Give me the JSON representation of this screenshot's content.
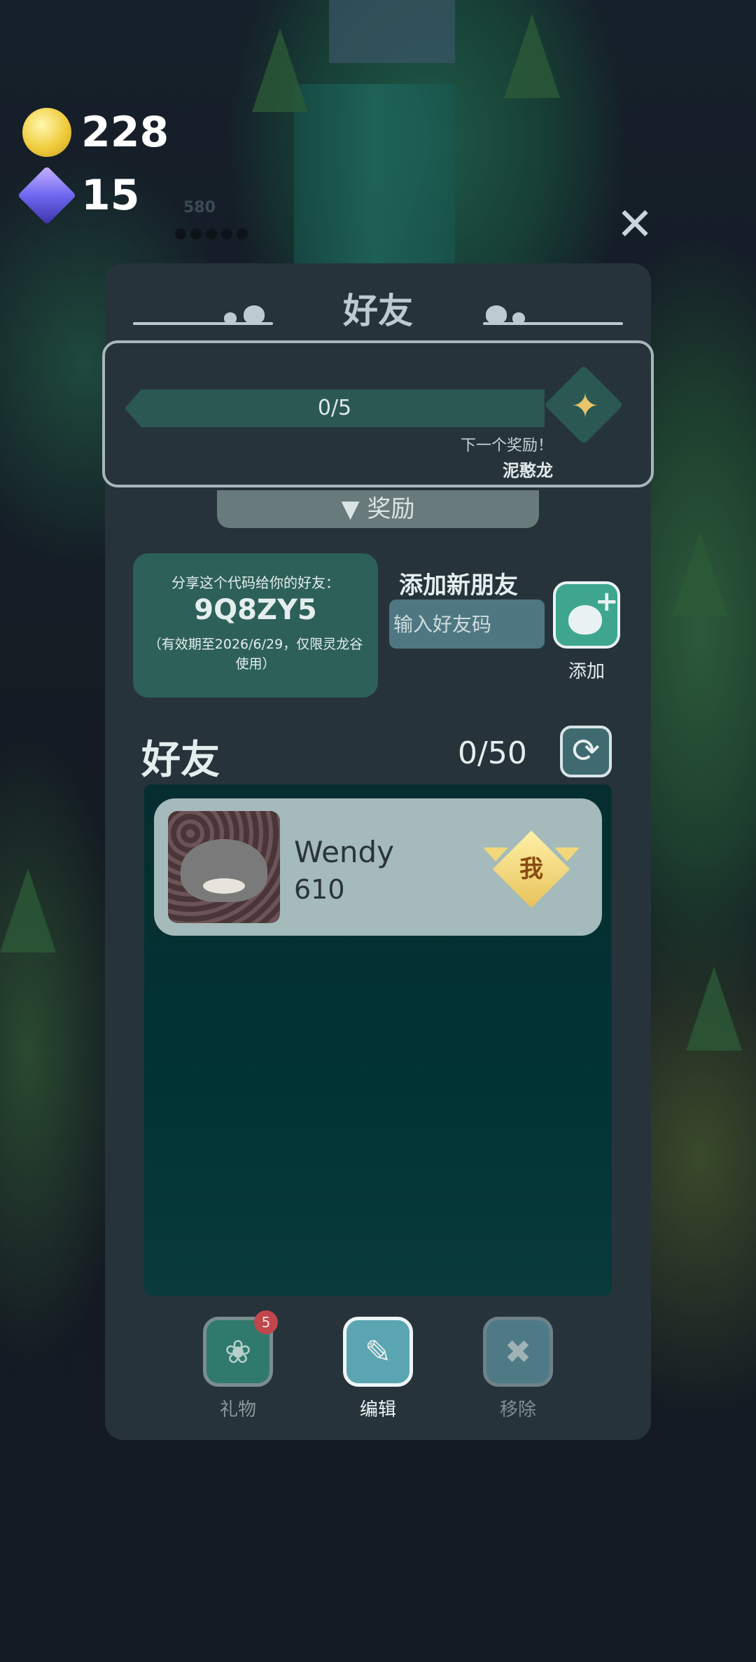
{
  "hud": {
    "coins": "228",
    "gems": "15"
  },
  "background": {
    "ghost_score": "580"
  },
  "panel": {
    "title": "好友",
    "progress": {
      "text": "0/5",
      "value": 0,
      "max": 5,
      "next_reward_label": "下一个奖励！",
      "reward_name": "泥憨龙"
    },
    "reward_tab": "▼ 奖励",
    "share": {
      "label": "分享这个代码给你的好友：",
      "code": "9Q8ZY5",
      "note": "（有效期至2026/6/29，仅限灵龙谷使用）"
    },
    "add_friend": {
      "title": "添加新朋友",
      "placeholder": "输入好友码",
      "button_label": "添加"
    },
    "friends": {
      "title": "好友",
      "count": "0/50",
      "items": [
        {
          "name": "Wendy",
          "score": "610",
          "badge": "我"
        }
      ]
    },
    "actions": [
      {
        "label": "礼物",
        "badge": "5",
        "icon": "gift-icon"
      },
      {
        "label": "编辑",
        "icon": "edit-icon"
      },
      {
        "label": "移除",
        "icon": "remove-friend-icon"
      }
    ]
  },
  "colors": {
    "panel": "#27333b",
    "accent": "#3ea68f",
    "share_card": "#2d6059"
  }
}
